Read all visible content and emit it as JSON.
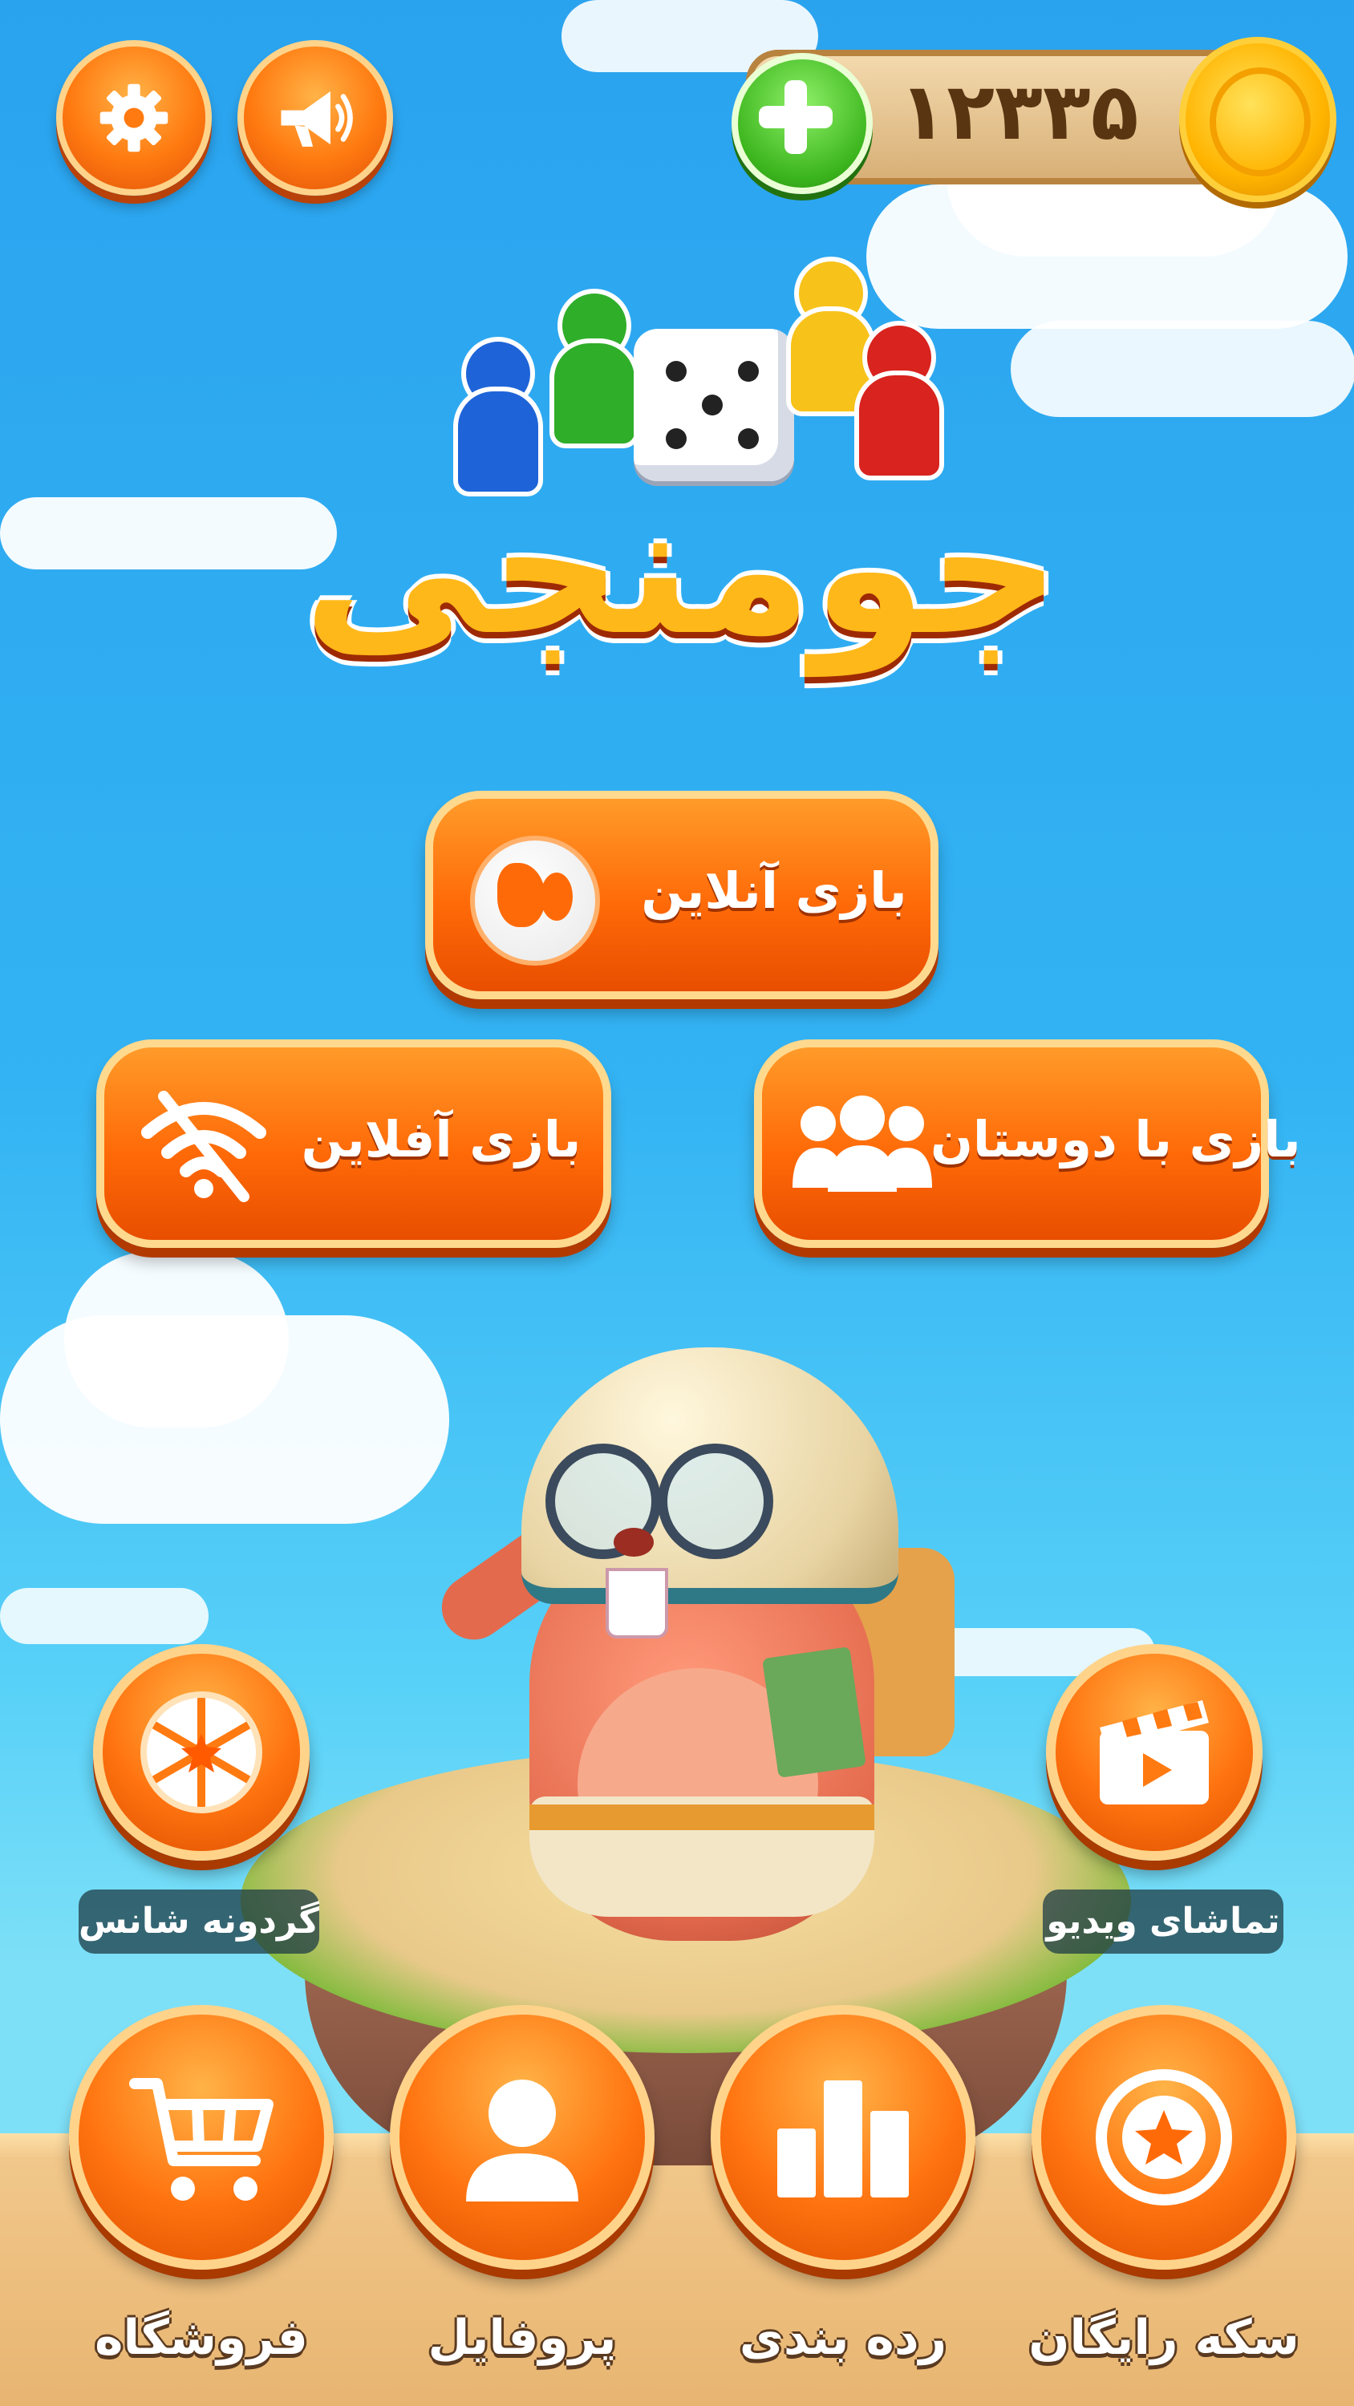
{
  "header": {
    "coins": "۱۲۳۳۵",
    "settings_icon": "gear-icon",
    "announce_icon": "megaphone-icon",
    "add_coins_icon": "plus-icon",
    "coin_icon": "gold-coin-icon"
  },
  "logo": {
    "title": "جومنجی"
  },
  "menu": {
    "online": "بازی آنلاین",
    "offline": "بازی آفلاین",
    "friends": "بازی با دوستان"
  },
  "side": {
    "wheel": "گردونه شانس",
    "video": "تماشای ویدیو"
  },
  "bottom": {
    "shop": "فروشگاه",
    "profile": "پروفایل",
    "ranking": "رده بندی",
    "free_coins": "سکه رایگان"
  },
  "colors": {
    "accent": "#ff6a08",
    "sky": "#2aa3ef",
    "add_green": "#3bb51d",
    "coin_gold": "#ffb400"
  }
}
